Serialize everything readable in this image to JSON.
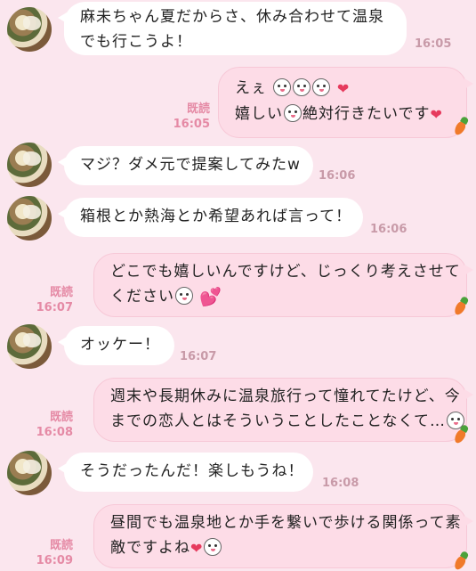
{
  "messages": [
    {
      "dir": "in",
      "lines": [
        "麻未ちゃん夏だからさ、休み合わせて温泉",
        "でも行こうよ！"
      ],
      "time": "16:05"
    },
    {
      "dir": "out",
      "line1": "えぇ",
      "line2a": "嬉しい",
      "line2b": "絶対行きたいです",
      "read": "既読",
      "time": "16:05"
    },
    {
      "dir": "in",
      "text": "マジ？ダメ元で提案してみたw",
      "time": "16:06"
    },
    {
      "dir": "in",
      "text": "箱根とか熱海とか希望あれば言って！",
      "time": "16:06"
    },
    {
      "dir": "out",
      "line1": "どこでも嬉しいんですけど、じっくり考えさせて",
      "line2": "ください",
      "read": "既読",
      "time": "16:07"
    },
    {
      "dir": "in",
      "text": "オッケー！",
      "time": "16:07"
    },
    {
      "dir": "out",
      "line1": "週末や長期休みに温泉旅行って憧れてたけど、今",
      "line2": "までの恋人とはそういうことしたことなくて…",
      "read": "既読",
      "time": "16:08"
    },
    {
      "dir": "in",
      "text": "そうだったんだ！楽しもうね！",
      "time": "16:08"
    },
    {
      "dir": "out",
      "line1": "昼間でも温泉地とか手を繋いで歩ける関係って素",
      "line2": "敵ですよね",
      "read": "既読",
      "time": "16:09"
    }
  ],
  "icons": {
    "avatar": "food-photo-avatar",
    "sticker": "rabbit-face-emoji",
    "heart": "red-heart",
    "carrot": "carrot-icon"
  },
  "colors": {
    "background": "#fbe6ee",
    "incoming_bubble": "#ffffff",
    "outgoing_bubble": "#fddce7",
    "read_label": "#e58aa5",
    "time_label": "#c89aa8"
  }
}
